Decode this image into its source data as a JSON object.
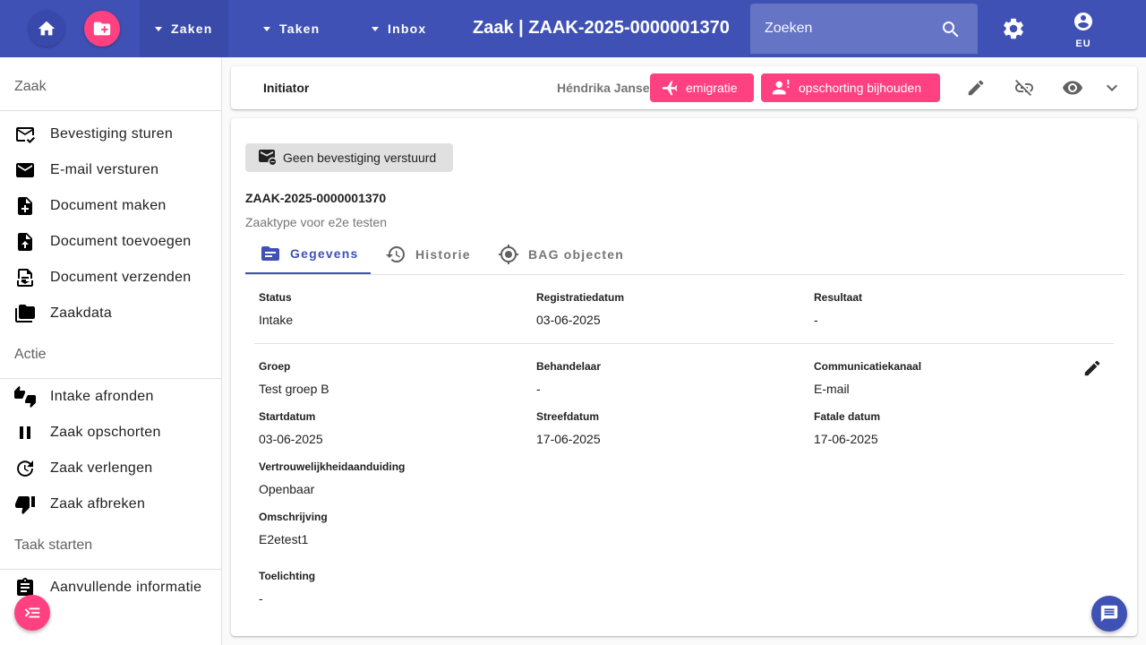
{
  "topbar": {
    "nav": [
      "Zaken",
      "Taken",
      "Inbox"
    ],
    "title": "Zaak | ZAAK-2025-0000001370",
    "search_placeholder": "Zoeken",
    "user_label": "EU"
  },
  "sidebar": {
    "sections": [
      {
        "header": "Zaak",
        "items": [
          "Bevestiging sturen",
          "E-mail versturen",
          "Document maken",
          "Document toevoegen",
          "Document verzenden",
          "Zaakdata"
        ]
      },
      {
        "header": "Actie",
        "items": [
          "Intake afronden",
          "Zaak opschorten",
          "Zaak verlengen",
          "Zaak afbreken"
        ]
      },
      {
        "header": "Taak starten",
        "items": [
          "Aanvullende informatie"
        ]
      }
    ]
  },
  "initiator": {
    "label": "Initiator",
    "name": "Héndrika Janse",
    "buttons": [
      "emigratie",
      "opschorting bijhouden"
    ]
  },
  "case": {
    "chip": "Geen bevestiging verstuurd",
    "id": "ZAAK-2025-0000001370",
    "type": "Zaaktype voor e2e testen",
    "tabs": [
      "Gegevens",
      "Historie",
      "BAG objecten"
    ],
    "fields": {
      "status": {
        "label": "Status",
        "value": "Intake"
      },
      "registratiedatum": {
        "label": "Registratiedatum",
        "value": "03-06-2025"
      },
      "resultaat": {
        "label": "Resultaat",
        "value": "-"
      },
      "groep": {
        "label": "Groep",
        "value": "Test groep B"
      },
      "behandelaar": {
        "label": "Behandelaar",
        "value": "-"
      },
      "communicatiekanaal": {
        "label": "Communicatiekanaal",
        "value": "E-mail"
      },
      "startdatum": {
        "label": "Startdatum",
        "value": "03-06-2025"
      },
      "streefdatum": {
        "label": "Streefdatum",
        "value": "17-06-2025"
      },
      "fatale_datum": {
        "label": "Fatale datum",
        "value": "17-06-2025"
      },
      "vertrouwelijkheid": {
        "label": "Vertrouwelijkheidaanduiding",
        "value": "Openbaar"
      },
      "omschrijving": {
        "label": "Omschrijving",
        "value": "E2etest1"
      },
      "toelichting": {
        "label": "Toelichting",
        "value": "-"
      }
    }
  },
  "colors": {
    "primary": "#3f51b5",
    "accent": "#ff4081"
  }
}
